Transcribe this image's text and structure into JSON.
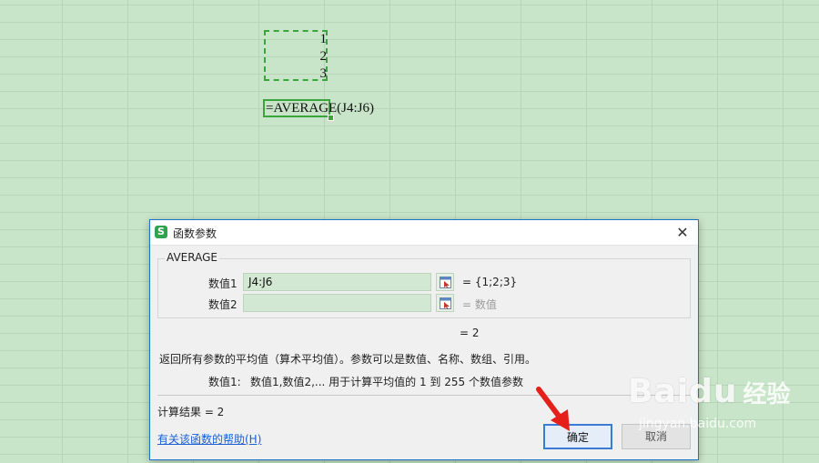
{
  "sheet": {
    "cell_values": [
      "1",
      "2",
      "3"
    ],
    "formula": "=AVERAGE(J4:J6)"
  },
  "dialog": {
    "title": "函数参数",
    "app_icon_letter": "S",
    "close_glyph": "✕",
    "function_name": "AVERAGE",
    "args": [
      {
        "label": "数值1",
        "value": "J4:J6",
        "result": "= {1;2;3}"
      },
      {
        "label": "数值2",
        "value": "",
        "result": "= 数值"
      }
    ],
    "total_result": "=   2",
    "description": "返回所有参数的平均值（算术平均值）。参数可以是数值、名称、数组、引用。",
    "arg_desc_label": "数值1:",
    "arg_desc_text": "数值1,数值2,... 用于计算平均值的 1 到 255 个数值参数",
    "calc_result": "计算结果  =  2",
    "help_link": "有关该函数的帮助(H)",
    "ok_label": "确定",
    "cancel_label": "取消"
  },
  "watermark": {
    "logo": "Baidu",
    "brand": "经验",
    "url": "jingyan.baidu.com"
  },
  "icons": {
    "annotation_arrow": "red-arrow-icon",
    "ref_picker": "range-select-icon"
  },
  "colors": {
    "sheet_bg": "#c9e5c9",
    "selection": "#3aa53a",
    "dialog_border": "#1a73c9",
    "link": "#1a5fd6",
    "arrow": "#e5201a"
  }
}
